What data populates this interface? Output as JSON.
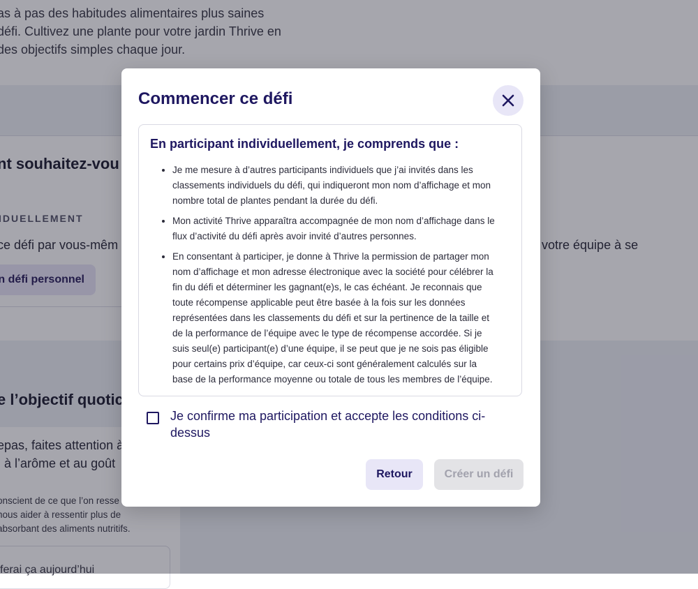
{
  "background": {
    "intro_lines": [
      "as à pas des habitudes alimentaires plus saines",
      "défi. Cultivez une plante pour votre jardin Thrive en",
      " des objectifs simples chaque jour."
    ],
    "section_title": "nt souhaitez-vou",
    "individual_label": "IDUELLEMENT",
    "individual_desc": "ce défi par vous-mêm",
    "team_desc": "ez votre équipe à se",
    "personal_challenge_button": "n défi personnel",
    "goal_title": "e l’objectif quotic",
    "goal_line1": "epas, faites attention à",
    "goal_line2": ", à l’arôme et au goût",
    "goal_small_lines": [
      "onscient de ce que l’on resse",
      " nous aider à ressentir plus de",
      " absorbant des aliments nutritifs."
    ],
    "goal_input_text": " ferai ça aujourd’hui"
  },
  "modal": {
    "title": "Commencer ce défi",
    "close_icon": "close-icon",
    "terms_heading": "En participant individuellement, je comprends que :",
    "terms": [
      [
        "Je me mesure à d’autres participants individuels que j’ai invités dans les",
        "classements individuels du défi, qui indiqueront mon nom d’affichage et mon",
        "nombre total de plantes pendant la durée du défi."
      ],
      [
        "Mon activité Thrive apparaîtra accompagnée de mon nom d’affichage dans le",
        "flux d’activité du défi après avoir invité d’autres personnes."
      ],
      [
        "En consentant à participer, je donne à Thrive la permission de partager mon",
        "nom d’affichage et mon adresse électronique avec la société pour célébrer la",
        "fin du défi et déterminer les gagnant(e)s, le cas échéant. Je reconnais que",
        "toute récompense applicable peut être basée à la fois sur les données",
        "représentées dans les classements du défi et sur la pertinence de la taille et",
        "de la performance de l’équipe avec le type de récompense accordée. Si je",
        "suis seul(e) participant(e) d’une équipe, il se peut que je ne sois pas éligible",
        "pour certains prix d’équipe, car ceux-ci sont généralement calculés sur la",
        "base de la performance moyenne ou totale de tous les membres de l’équipe."
      ]
    ],
    "confirm_lines": [
      "Je confirme ma participation et accepte les conditions ci-",
      "dessus"
    ],
    "confirm_checked": false,
    "back_label": "Retour",
    "create_label": "Créer un défi"
  },
  "colors": {
    "brand": "#1e1760",
    "secondary_button_bg": "#e8e6f7",
    "disabled_button_bg": "#e3e3e6",
    "disabled_button_text": "#a2a2ad"
  }
}
